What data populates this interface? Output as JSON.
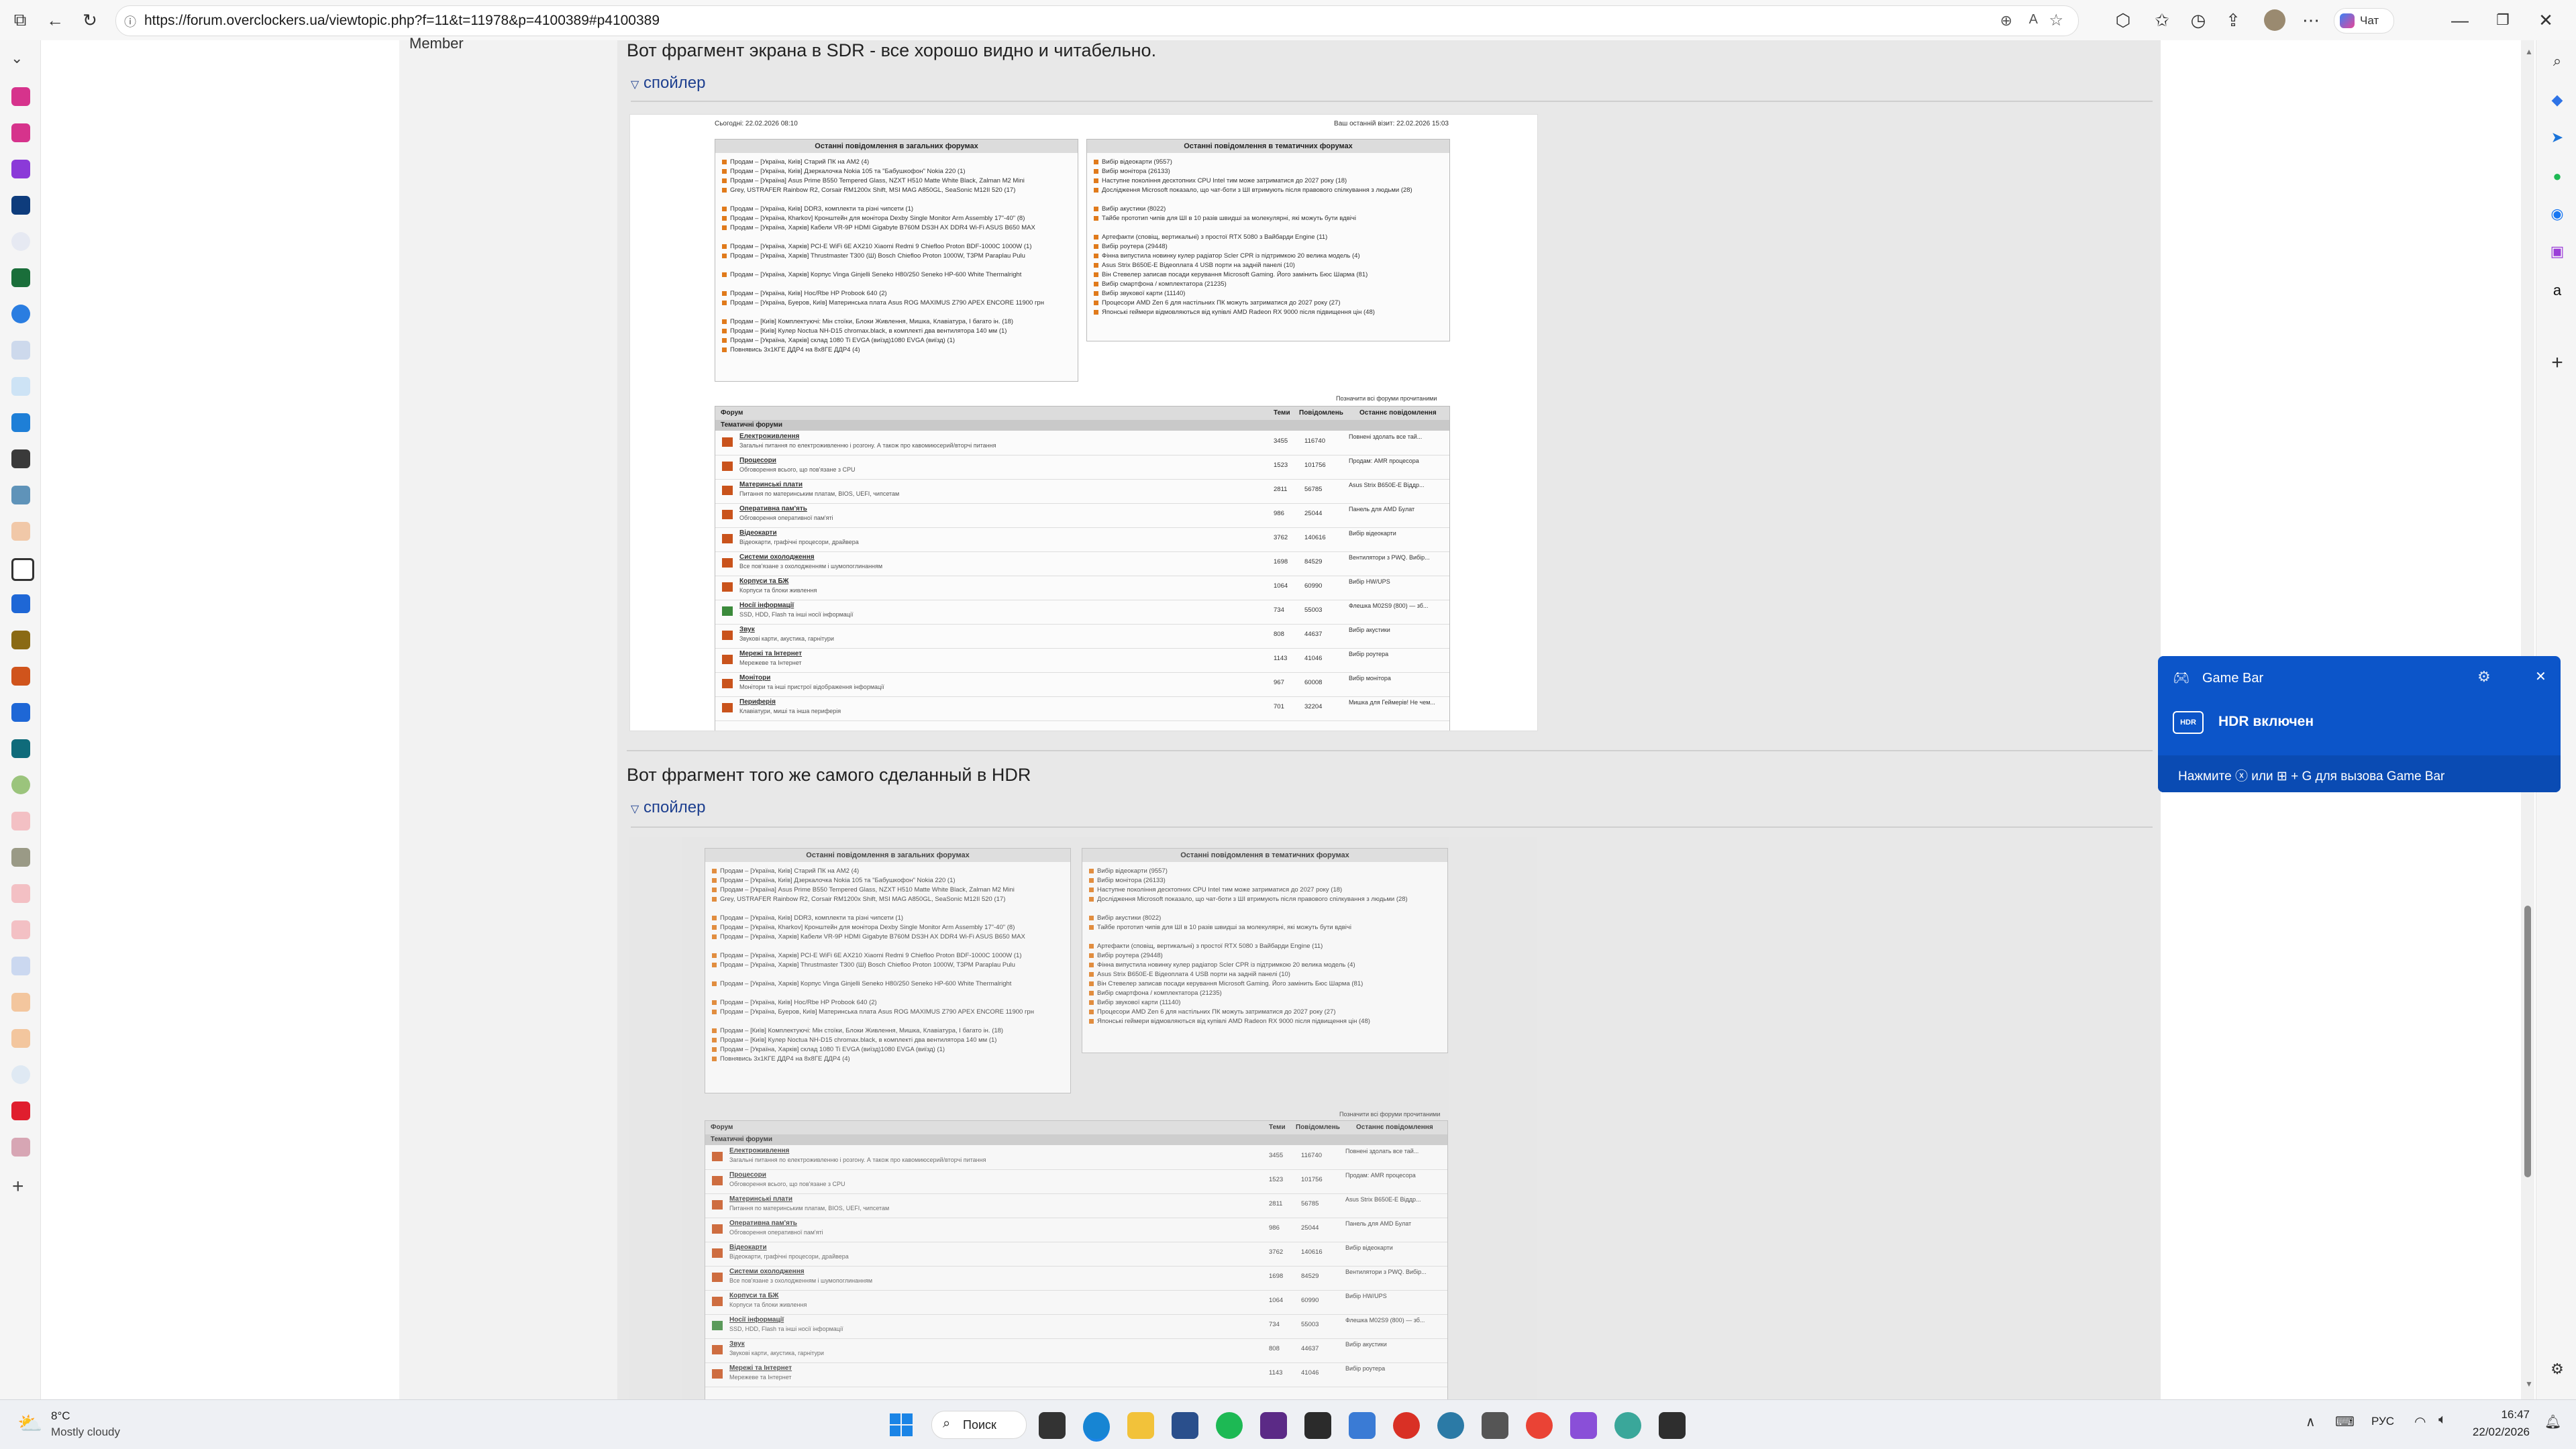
{
  "browser": {
    "url": "https://forum.overclockers.ua/viewtopic.php?f=11&t=11978&p=4100389#p4100389",
    "chat_label": "Чат"
  },
  "post": {
    "member_label": "Member",
    "sdr_caption": "Вот фрагмент экрана в SDR - все хорошо видно и читабельно.",
    "hdr_caption": "Вот фрагмент того же самого сделанный в HDR",
    "spoiler_label": "спойлер"
  },
  "screenshot": {
    "top_left": "Сьогодні: 22.02.2026 08:10",
    "top_right": "Ваш останній візит: 22.02.2026 15:03",
    "left_box_title": "Останні повідомлення в загальних форумах",
    "right_box_title": "Останні повідомлення в тематичних форумах",
    "left_items": [
      "Продам – [Україна, Київ] Старий ПК на AM2 (4)",
      "Продам – [Україна, Київ] Дзеркалочка Nokia 105 та \"Бабушкофон\" Nokia 220 (1)",
      "Продам – [Україна] Asus Prime B550 Tempered Glass, NZXT H510 Matte White Black, Zalman M2 Mini",
      "Grey, USTRAFER Rainbow R2, Corsair RM1200x Shift, MSI MAG A850GL, SeaSonic M12II 520 (17)",
      "Продам – [Україна, Київ] DDR3, комплекти та різні чипсети (1)",
      "Продам – [Україна, Кharkov] Кронштейн для монітора Dexby Single Monitor Arm Assembly 17\"-40\" (8)",
      "Продам – [Україна, Харків] Кабели VR-9P HDMI Gigabyte B760M DS3H AX DDR4 Wi-Fi ASUS B650 MAX",
      "Продам – [Україна, Харків] PCI-E WiFi 6E AX210 Xiaomi Redmi 9 Chiefloo Proton BDF-1000C 1000W (1)",
      "Продам – [Україна, Харків] Thrustmaster T300 (Ш) Bosch Chiefloo Proton 1000W, T3PM Paraplau Pulu",
      "Продам – [Україна, Харків] Корпус Vinga Ginjelli Seneko H80/250 Seneko HP-600 White Thermalright",
      "Продам – [Україна, Київ] Hoc/Rbe HP Probook 640 (2)",
      "Продам – [Україна, Буеров, Київ] Материнська плата Asus ROG MAXIMUS Z790 APEX ENCORE 11900 грн",
      "Продам – [Київ] Комплектуючі: Мiн стоїки, Блоки Живлення, Мишка, Клавіатура, І багато ін. (18)",
      "Продам – [Київ] Кулер Noctua NH-D15 chromax.black, в комплекті два вентилятора 140 мм (1)",
      "Продам – [Україна, Харків] склад 1080 Ti EVGA (виїзд)1080 EVGA (виїзд) (1)",
      "Повнявись 3х1КГЕ ДДР4 на 8х8ГЕ ДДР4 (4)"
    ],
    "right_items": [
      "Вибір відеокарти (9557)",
      "Вибір монітора (26133)",
      "Наступне покоління десктопних CPU Intel тим може затриматися до 2027 року (18)",
      "Дослідження Microsoft показало, що чат-боти з ШІ втримують після правового спілкування з людьми (28)",
      "Вибір акустики (8022)",
      "Тайбе прототип чипів для ШІ в 10 разів швидші за молекулярні, які можуть бути вдвічі",
      "Артефакти (сповіщ, вертикальні) з простої RTX 5080 з Вайбарди Engine (11)",
      "Вибір роутера (29448)",
      "Фінна випустила новинку кулер радіатор Scler CPR із підтримкою 20 велика модель (4)",
      "Asus Strix B650E-E Відеоплата 4 USB порти на задній панелі (10)",
      "Він Стевелер записав посади керування Microsoft Gaming. Його замінить Бюс Шарма (81)",
      "Вибір смартфона / комплектатора (21235)",
      "Вибір звукової карти (11140)",
      "Процесори AMD Zen 6 для настільних ПК можуть затриматися до 2027 року (27)",
      "Японські геймери відмовляються від купівлі AMD Radeon RX 9000 після підвищення цін (48)"
    ],
    "mark_all_read": "Позначити всі форуми прочитаними",
    "table_headers": [
      "Форум",
      "Теми",
      "Повідомлень",
      "Останнє повідомлення"
    ],
    "section_title": "Тематичні форуми",
    "forums": [
      {
        "name": "Електроживлення",
        "desc": "Загальні питання по електроживленню і розгону. А також про кавомиюсерий/вторчі питання",
        "topics": "3455",
        "posts": "116740",
        "last": "Повнені здолать все тай..."
      },
      {
        "name": "Процесори",
        "desc": "Обговорення всього, що пов'язане з CPU",
        "topics": "1523",
        "posts": "101756",
        "last": "Продам: AMR процесора"
      },
      {
        "name": "Материнські плати",
        "desc": "Питання по материнським платам, BIOS, UEFI, чипсетам",
        "topics": "2811",
        "posts": "56785",
        "last": "Asus Strix B650E-E Віддр..."
      },
      {
        "name": "Оперативна пам'ять",
        "desc": "Обговорення оперативної пам'яті",
        "topics": "986",
        "posts": "25044",
        "last": "Панель для AMD Булат"
      },
      {
        "name": "Відеокарти",
        "desc": "Відеокарти, графічні процесори, драйвера",
        "topics": "3762",
        "posts": "140616",
        "last": "Вибір відеокарти"
      },
      {
        "name": "Системи охолодження",
        "desc": "Все пов'язане з охолодженням і шумопоглинанням",
        "topics": "1698",
        "posts": "84529",
        "last": "Вентилятори з PWQ. Вибір..."
      },
      {
        "name": "Корпуси та БЖ",
        "desc": "Корпуси та блоки живлення",
        "topics": "1064",
        "posts": "60990",
        "last": "Вибір HW/UPS"
      },
      {
        "name": "Носії інформації",
        "desc": "SSD, HDD, Flash та інші носії інформації",
        "topics": "734",
        "posts": "55003",
        "last": "Флешка M02S9 (800) — зб..."
      },
      {
        "name": "Звук",
        "desc": "Звукові карти, акустика, гарнітури",
        "topics": "808",
        "posts": "44637",
        "last": "Вибір акустики"
      },
      {
        "name": "Мережі та Інтернет",
        "desc": "Мережеве та Інтернет",
        "topics": "1143",
        "posts": "41046",
        "last": "Вибір роутера"
      },
      {
        "name": "Монітори",
        "desc": "Монітори та інші пристрої відображення інформації",
        "topics": "967",
        "posts": "60008",
        "last": "Вибір монітора"
      },
      {
        "name": "Периферія",
        "desc": "Клавіатури, миші та інша периферія",
        "topics": "701",
        "posts": "32204",
        "last": "Мишка для Геймерів! Не чем..."
      }
    ]
  },
  "gamebar": {
    "title": "Game Bar",
    "status": "HDR включен",
    "hint": "Нажмите ⓧ или ⊞ + G для вызова Game Bar"
  },
  "taskbar": {
    "temperature": "8°C",
    "weather": "Mostly cloudy",
    "search_label": "Поиск",
    "language": "РУС",
    "time": "16:47",
    "date": "22/02/2026"
  }
}
